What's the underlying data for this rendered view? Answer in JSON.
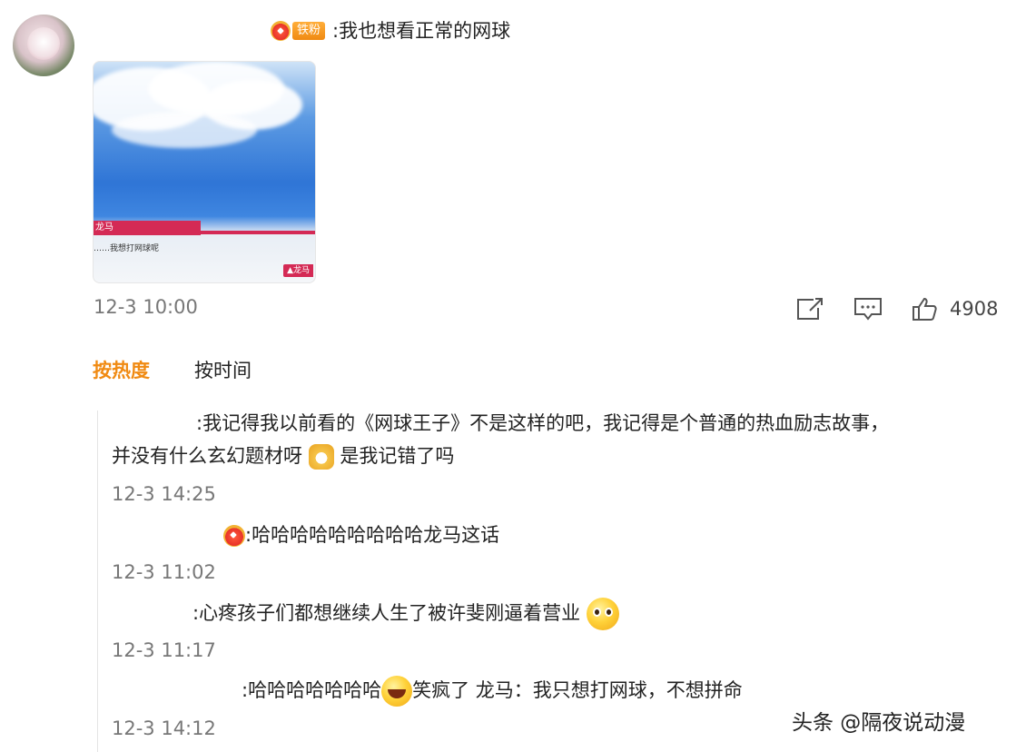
{
  "post": {
    "fan_badge": "铁粉",
    "text": ":我也想看正常的网球",
    "image": {
      "bar_label": "龙马",
      "caption": "……我想打网球呢",
      "corner_button": "▲龙马"
    },
    "time": "12-3 10:00",
    "actions": {
      "share_icon": "share-icon",
      "comment_icon": "comment-icon",
      "like_icon": "thumbs-up-icon",
      "like_count": "4908"
    }
  },
  "sort": {
    "by_hot": "按热度",
    "by_time": "按时间",
    "accent": "#f08a12"
  },
  "comments": [
    {
      "line1": ":我记得我以前看的《网球王子》不是这样的吧，我记得是个普通的热血励志故事，",
      "line2_before": "并没有什么玄幻题材呀",
      "line2_after": "是我记错了吗",
      "emoji": "dog-emoji",
      "time": "12-3 14:25"
    },
    {
      "text": ":哈哈哈哈哈哈哈哈哈龙马这话",
      "time": "12-3 11:02"
    },
    {
      "text": ":心疼孩子们都想继续人生了被许斐刚逼着营业",
      "emoji": "pleading-face-emoji",
      "time": "12-3 11:17"
    },
    {
      "text_before": ":哈哈哈哈哈哈哈",
      "text_after": "笑疯了 龙马：我只想打网球，不想拼命",
      "emoji": "laughing-emoji",
      "time": "12-3 14:12"
    }
  ],
  "watermark": "头条 @隔夜说动漫"
}
